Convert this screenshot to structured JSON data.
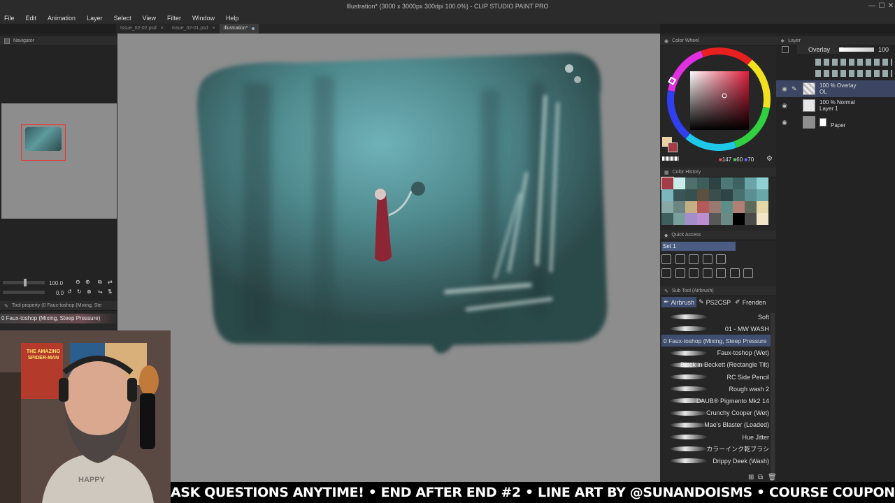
{
  "window": {
    "title": "Illustration* (3000 x 3000px 300dpi 100.0%) - CLIP STUDIO PAINT PRO"
  },
  "menu": [
    "File",
    "Edit",
    "Animation",
    "Layer",
    "Select",
    "View",
    "Filter",
    "Window",
    "Help"
  ],
  "tabs": [
    {
      "label": "Issue_02-02.psd",
      "active": false
    },
    {
      "label": "Issue_02-01.psd",
      "active": false
    },
    {
      "label": "Illustration*",
      "active": true
    }
  ],
  "navigator": {
    "title": "Navigator",
    "zoom": "100.0",
    "rotation": "0.0"
  },
  "tool_property": {
    "title": "Tool property (0 Faux-toshop (Mixing, Ste",
    "brush_name": "0 Faux-toshop (Mixing, Steep Pressure)"
  },
  "color_wheel": {
    "title": "Color Wheel",
    "r": "147",
    "g": "60",
    "b": "70",
    "main_color": "#e9d2a6",
    "sub_color": "#a33c46"
  },
  "color_history": {
    "title": "Color History",
    "swatches": [
      "#a33c46",
      "#c9ece9",
      "#4f6f6a",
      "#3e5c59",
      "#2d4241",
      "#4e7878",
      "#3c6361",
      "#6aa4a8",
      "#8fd0d4",
      "#79b6bd",
      "#3a5557",
      "#365050",
      "#5c5040",
      "#3b4e4e",
      "#2f4446",
      "#49706f",
      "#5b8f91",
      "#6aa7a9",
      "#88a8a6",
      "#6a8582",
      "#c6ae84",
      "#b55a58",
      "#9a7a70",
      "#5e8e8a",
      "#b27f75",
      "#5f6b5a",
      "#e5d8a8",
      "#3f5e5e",
      "#7a9e9b",
      "#a58dc9",
      "#ba8ed0",
      "#585858",
      "#6b8a86",
      "#000000",
      "#4a4a4a",
      "#f0e6c6"
    ]
  },
  "quick_access": {
    "title": "Quick Access",
    "set": "Set 1"
  },
  "sub_tool": {
    "title": "Sub Tool (Airbrush)",
    "tabs": [
      "Airbrush",
      "PS2CSP",
      "Frenden"
    ],
    "brushes": [
      {
        "name": "Soft",
        "selected": false
      },
      {
        "name": "01 - MW WASH",
        "selected": false
      },
      {
        "name": "0 Faux-toshop (Mixing, Steep Pressure",
        "selected": true
      },
      {
        "name": "Faux-toshop (Wet)",
        "selected": false
      },
      {
        "name": "Block in Beckett (Rectangle Tilt)",
        "selected": false
      },
      {
        "name": "RC Side Pencil",
        "selected": false
      },
      {
        "name": "Rough wash 2",
        "selected": false
      },
      {
        "name": "DAUB® Pigmento Mk2 14",
        "selected": false
      },
      {
        "name": "Crunchy Cooper (Wet)",
        "selected": false
      },
      {
        "name": "Mae's Blaster (Loaded)",
        "selected": false
      },
      {
        "name": "Hue Jitter",
        "selected": false
      },
      {
        "name": "カラーインク乾ブラシ",
        "selected": false
      },
      {
        "name": "Drippy Deek (Wash)",
        "selected": false
      }
    ]
  },
  "layer_panel": {
    "title": "Layer",
    "blend_mode": "Overlay",
    "opacity": "100",
    "layers": [
      {
        "line1": "100 % Overlay",
        "line2": "OL",
        "selected": true
      },
      {
        "line1": "100 % Normal",
        "line2": "Layer 1",
        "selected": false
      },
      {
        "line1": "",
        "line2": "Paper",
        "selected": false
      }
    ]
  },
  "webcam": {
    "poster_line1": "THE AMAZING",
    "poster_line2": "SPIDER-MAN",
    "shirt_text": "HAPPY"
  },
  "banner": {
    "text": "ASK QUESTIONS ANYTIME! • END AFTER END #2 • LINE ART BY @SUNANDOISMS • COURSE COUPON IN DESC"
  }
}
